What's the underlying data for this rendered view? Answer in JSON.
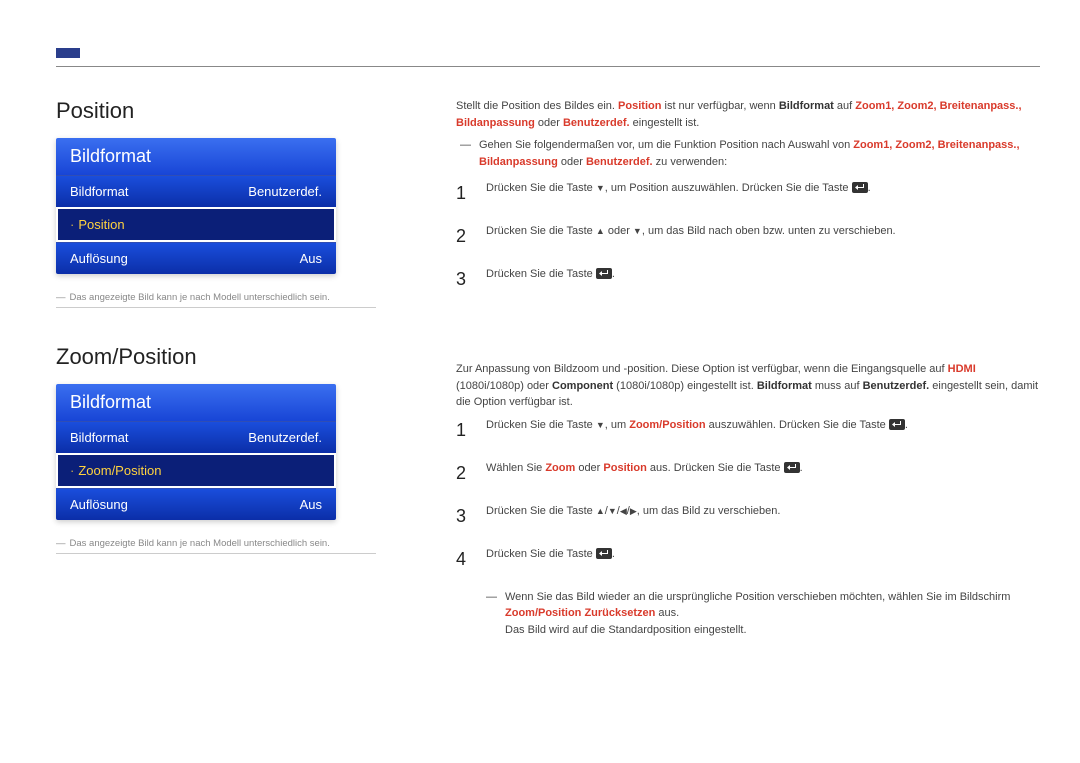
{
  "section1": {
    "title": "Position",
    "menu": {
      "header": "Bildformat",
      "row1_label": "Bildformat",
      "row1_value": "Benutzerdef.",
      "row2_label": "Position",
      "row3_label": "Auflösung",
      "row3_value": "Aus"
    },
    "note": "Das angezeigte Bild kann je nach Modell unterschiedlich sein.",
    "content": {
      "intro_pre": "Stellt die Position des Bildes ein. ",
      "intro_mid": " ist nur verfügbar, wenn ",
      "intro_on": " auf ",
      "intro_end": " eingestellt ist.",
      "kw_position": "Position",
      "kw_bildformat": "Bildformat",
      "kw_modes": "Zoom1, Zoom2, Breitenanpass., Bildanpassung",
      "kw_or": " oder ",
      "kw_benutzerdef": "Benutzerdef.",
      "sub_pre": "Gehen Sie folgendermaßen vor, um die Funktion ",
      "sub_mid": " nach Auswahl von ",
      "sub_modes": "Zoom1, Zoom2, Breitenanpass., Bildanpassung",
      "sub_end": " zu verwenden:",
      "step1_pre": "Drücken Sie die Taste ",
      "step1_mid": ", um ",
      "step1_post": " auszuwählen. Drücken Sie die Taste ",
      "step1_end": ".",
      "step2_pre": "Drücken Sie die Taste ",
      "step2_mid": " oder ",
      "step2_post": ", um das Bild nach oben bzw. unten zu verschieben.",
      "step3_pre": "Drücken Sie die Taste ",
      "step3_end": "."
    }
  },
  "section2": {
    "title": "Zoom/Position",
    "menu": {
      "header": "Bildformat",
      "row1_label": "Bildformat",
      "row1_value": "Benutzerdef.",
      "row2_label": "Zoom/Position",
      "row3_label": "Auflösung",
      "row3_value": "Aus"
    },
    "note": "Das angezeigte Bild kann je nach Modell unterschiedlich sein.",
    "content": {
      "intro_pre": "Zur Anpassung von Bildzoom und -position. Diese Option ist verfügbar, wenn die Eingangsquelle auf ",
      "kw_hdmi": "HDMI",
      "intro_hdmi_spec": " (1080i/1080p) oder ",
      "kw_component": "Component",
      "intro_comp_spec": " (1080i/1080p) eingestellt ist. ",
      "kw_bildformat": "Bildformat",
      "intro_must": " muss auf ",
      "kw_benutzerdef": "Benutzerdef.",
      "intro_end": " eingestellt sein, damit die Option verfügbar ist.",
      "step1_pre": "Drücken Sie die Taste ",
      "step1_mid": ", um ",
      "kw_zoompos": "Zoom/Position",
      "step1_post": " auszuwählen. Drücken Sie die Taste ",
      "step1_end": ".",
      "step2_pre": "Wählen Sie ",
      "kw_zoom": "Zoom",
      "step2_or": " oder ",
      "kw_position": "Position",
      "step2_post": " aus. Drücken Sie die Taste ",
      "step2_end": ".",
      "step3_pre": "Drücken Sie die Taste ",
      "step3_post": ", um das Bild zu verschieben.",
      "step4_pre": "Drücken Sie die Taste ",
      "step4_end": ".",
      "tail_pre": "Wenn Sie das Bild wieder an die ursprüngliche Position verschieben möchten, wählen Sie im Bildschirm ",
      "tail_kw1": "Zoom/Position",
      "tail_kw2": " Zurücksetzen",
      "tail_post": " aus.",
      "tail2": "Das Bild wird auf die Standardposition eingestellt."
    }
  }
}
